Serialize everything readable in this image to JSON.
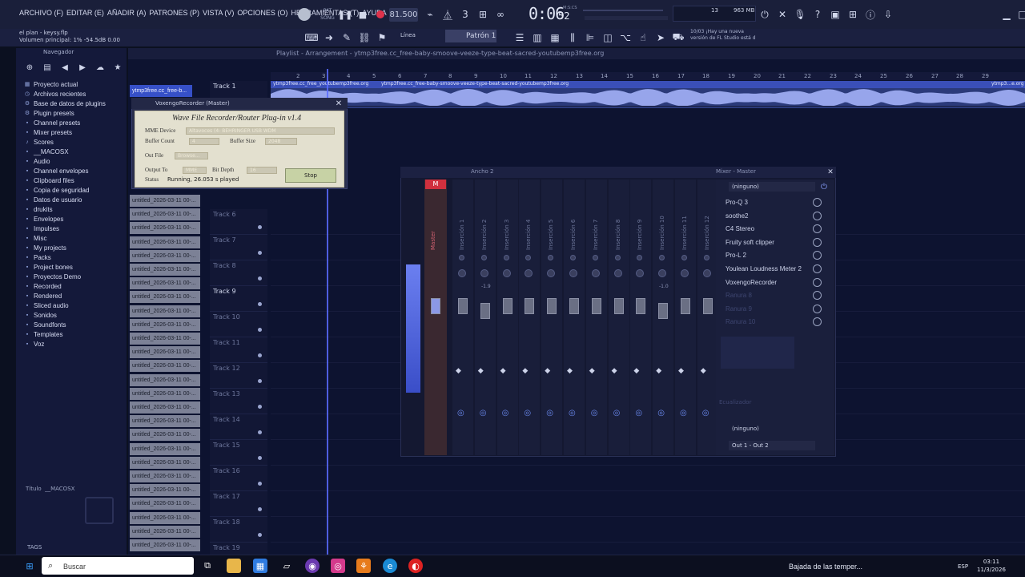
{
  "menu": {
    "items": [
      "ARCHIVO (F)",
      "EDITAR (E)",
      "AÑADIR (A)",
      "PATRONES (P)",
      "VISTA (V)",
      "OPCIONES (O)",
      "HERRAMIENTAS (T)",
      "AYUDA"
    ]
  },
  "toolbar": {
    "mode_pat": "PAT",
    "mode_song": "SONG",
    "tempo": "81.500",
    "time": "0:06",
    "time_ticks": "52",
    "time_unit": "M:S:CS",
    "cpu_count": "13",
    "memory": "963 MB",
    "hint_line1": "el plan - keysy.flp",
    "hint_line2": "Volumen principal: 1%  -54.5dB  0.00",
    "snap": "Línea",
    "pattern": "Patrón 1",
    "news_date": "10/03",
    "news_line1": "¡Hay una nueva",
    "news_line2": "versión de FL Studio está d"
  },
  "browser": {
    "header": "Navegador",
    "items": [
      {
        "label": "Proyecto actual",
        "icon": "grid"
      },
      {
        "label": "Archivos recientes",
        "icon": "clock"
      },
      {
        "label": "Base de datos de plugins",
        "icon": "plug"
      },
      {
        "label": "Plugin presets",
        "icon": "plug"
      },
      {
        "label": "Channel presets",
        "icon": "folder"
      },
      {
        "label": "Mixer presets",
        "icon": "folder"
      },
      {
        "label": "Scores",
        "icon": "note"
      },
      {
        "label": "__MACOSX",
        "icon": "folder"
      },
      {
        "label": "Audio",
        "icon": "folder"
      },
      {
        "label": "Channel envelopes",
        "icon": "folder"
      },
      {
        "label": "Clipboard files",
        "icon": "folder"
      },
      {
        "label": "Copia de seguridad",
        "icon": "folder"
      },
      {
        "label": "Datos de usuario",
        "icon": "folder"
      },
      {
        "label": "drukits",
        "icon": "folder"
      },
      {
        "label": "Envelopes",
        "icon": "folder"
      },
      {
        "label": "Impulses",
        "icon": "folder"
      },
      {
        "label": "Misc",
        "icon": "folder"
      },
      {
        "label": "My projects",
        "icon": "folder"
      },
      {
        "label": "Packs",
        "icon": "folder"
      },
      {
        "label": "Project bones",
        "icon": "folder"
      },
      {
        "label": "Proyectos Demo",
        "icon": "folder"
      },
      {
        "label": "Recorded",
        "icon": "folder"
      },
      {
        "label": "Rendered",
        "icon": "folder"
      },
      {
        "label": "Sliced audio",
        "icon": "folder"
      },
      {
        "label": "Sonidos",
        "icon": "folder"
      },
      {
        "label": "Soundfonts",
        "icon": "folder"
      },
      {
        "label": "Templates",
        "icon": "folder"
      },
      {
        "label": "Voz",
        "icon": "folder"
      }
    ],
    "titulo_label": "Título",
    "titulo_value": "__MACOSX",
    "tags": "TAGS"
  },
  "playlist": {
    "title": "Playlist - Arrangement - ytmp3free.cc_free-baby-smoove-veeze-type-beat-sacred-youtubemp3free.org",
    "clip_label": "ytmp3free.cc_free-baby-smoove-veeze-type-beat-sacred-youtubemp3free.org",
    "clip_label_short": "ytmp3free.cc_free_youtubemp3free.org",
    "clip_label_end": "ytmp3...e.org",
    "selected_clip": "ytmp3free.cc_free-b...",
    "ruler": [
      "2",
      "3",
      "4",
      "5",
      "6",
      "7",
      "8",
      "9",
      "10",
      "11",
      "12",
      "13",
      "14",
      "15",
      "16",
      "17",
      "18",
      "19",
      "20",
      "21",
      "22",
      "23",
      "24",
      "25",
      "26",
      "27",
      "28",
      "29"
    ],
    "tracks": [
      "Track 1",
      "Track 6",
      "Track 7",
      "Track 8",
      "Track 9",
      "Track 10",
      "Track 11",
      "Track 12",
      "Track 13",
      "Track 14",
      "Track 15",
      "Track 16",
      "Track 17",
      "Track 18",
      "Track 19"
    ],
    "clip_names": [
      "untitled_2026-03-11 00-...",
      "untitled_2026-03-11 00-...",
      "untitled_2026-03-11 00-...",
      "untitled_2026-03-11 00-...",
      "untitled_2026-03-11 00-...",
      "untitled_2026-03-11 00-...",
      "untitled_2026-03-11 00-...",
      "untitled_2026-03-11 00-...",
      "untitled_2026-03-11 00-...",
      "untitled_2026-03-11 00-...",
      "untitled_2026-03-11 00-...",
      "untitled_2026-03-11 00-...",
      "untitled_2026-03-11 00-...",
      "untitled_2026-03-11 00-...",
      "untitled_2026-03-11 00-...",
      "untitled_2026-03-11 00-...",
      "untitled_2026-03-11 00-...",
      "untitled_2026-03-11 00-...",
      "untitled_2026-03-11 00-...",
      "untitled_2026-03-11 00-...",
      "untitled_2026-03-11 00-...",
      "untitled_2026-03-11 00-...",
      "untitled_2026-03-11 00-...",
      "untitled_2026-03-11 00-...",
      "untitled_2026-03-11 00-...",
      "untitled_2026-03-11 00-..."
    ]
  },
  "recorder": {
    "window_title": "VoxengoRecorder (Master)",
    "heading": "Wave File Recorder/Router Plug-in v1.4",
    "mme_device_label": "MME Device",
    "mme_device_value": "Altavoces (4- BEHRINGER USB WDM",
    "buffer_count_label": "Buffer Count",
    "buffer_count_value": "4",
    "buffer_size_label": "Buffer Size",
    "buffer_size_value": "2048",
    "out_file_label": "Out File",
    "browse": "Browse...",
    "output_to_label": "Output To",
    "output_to_value": "MME",
    "bit_depth_label": "Bit Depth",
    "bit_depth_value": "16",
    "status_label": "Status",
    "status_value": "Running, 26.053 s played",
    "stop": "Stop"
  },
  "mixer": {
    "title": "Mixer - Master",
    "width_label": "Ancho 2",
    "master": "M",
    "master_label": "Master",
    "inserts": [
      "Inserción 1",
      "Inserción 2",
      "Inserción 3",
      "Inserción 4",
      "Inserción 5",
      "Inserción 6",
      "Inserción 7",
      "Inserción 8",
      "Inserción 9",
      "Inserción 10",
      "Inserción 11",
      "Inserción 12"
    ],
    "db_left": "-1.9",
    "db_right": "-1.0",
    "input": "(ninguno)",
    "fx": [
      {
        "name": "Pro-Q 3",
        "active": true
      },
      {
        "name": "soothe2",
        "active": true
      },
      {
        "name": "C4 Stereo",
        "active": true
      },
      {
        "name": "Fruity soft clipper",
        "active": true
      },
      {
        "name": "Pro-L 2",
        "active": true
      },
      {
        "name": "Youlean Loudness Meter 2",
        "active": true
      },
      {
        "name": "VoxengoRecorder",
        "active": true
      },
      {
        "name": "Ranura 8",
        "active": false
      },
      {
        "name": "Ranura 9",
        "active": false
      },
      {
        "name": "Ranura 10",
        "active": false
      }
    ],
    "ecualizador": "Ecualizador",
    "output_none": "(ninguno)",
    "output": "Out 1 - Out 2"
  },
  "taskbar": {
    "search": "Buscar",
    "weather": "Bajada de las temper...",
    "lang": "ESP",
    "time": "03:11",
    "date": "11/3/2026"
  }
}
